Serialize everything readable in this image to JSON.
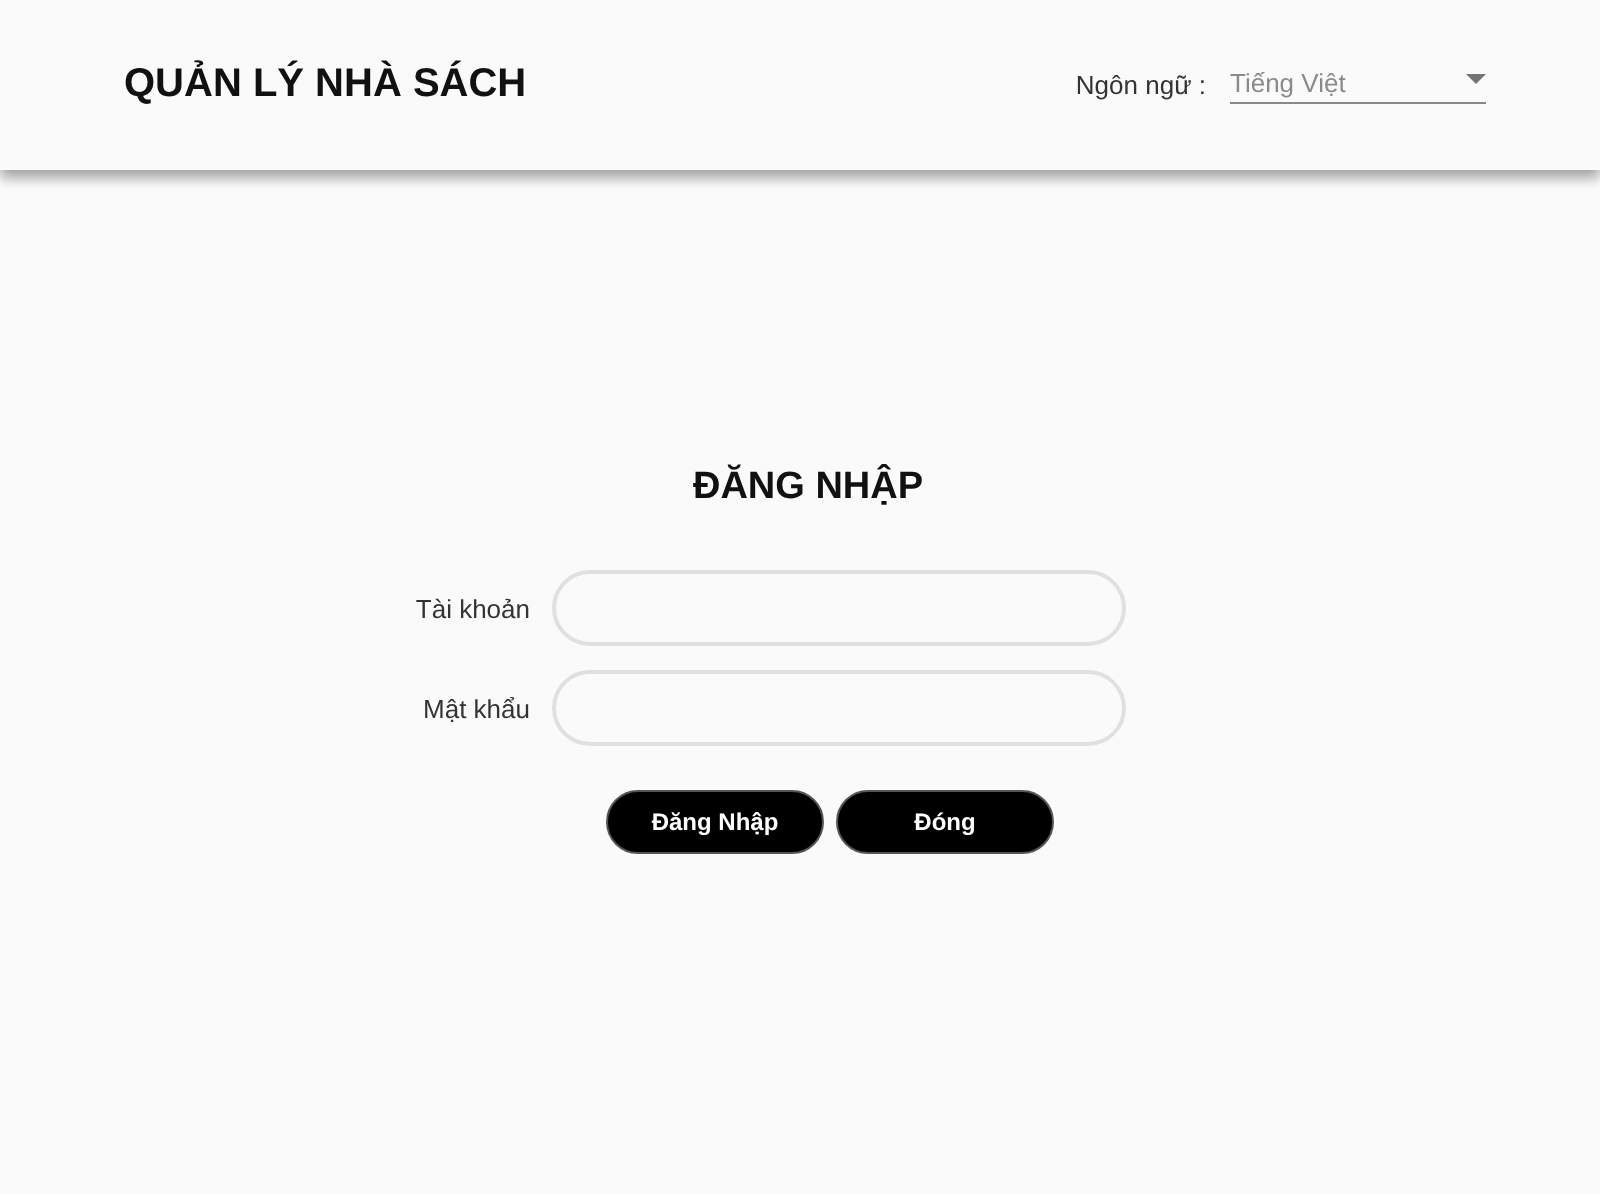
{
  "header": {
    "title": "QUẢN LÝ NHÀ SÁCH",
    "language_label": "Ngôn ngữ :",
    "language_select": {
      "value": "Tiếng Việt"
    }
  },
  "login": {
    "title": "ĐĂNG NHẬP",
    "fields": [
      {
        "label": "Tài khoản"
      },
      {
        "label": "Mật khẩu"
      }
    ],
    "buttons": [
      "Đăng Nhập",
      "Đóng"
    ]
  }
}
